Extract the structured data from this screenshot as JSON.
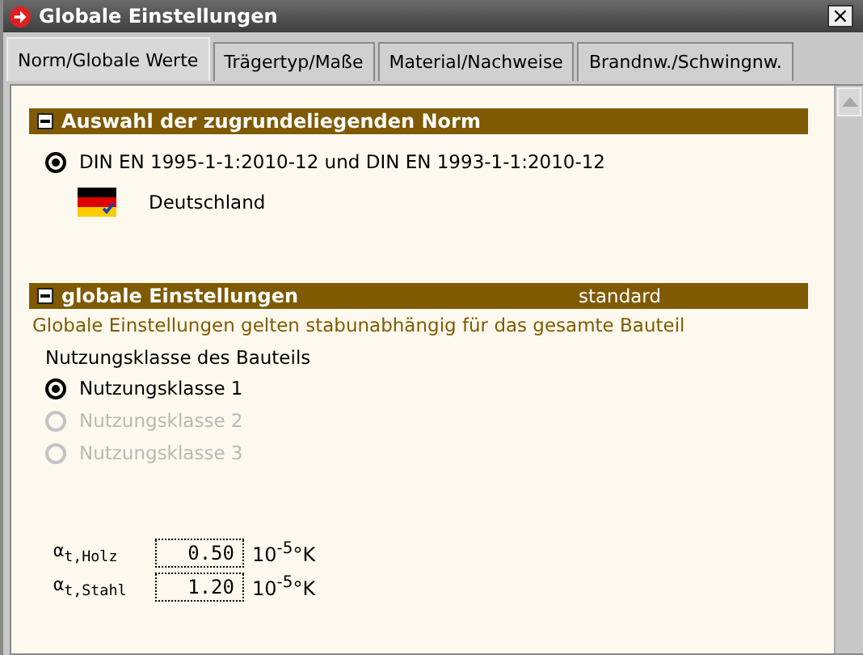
{
  "window": {
    "title": "Globale Einstellungen",
    "close": "×"
  },
  "tabs": [
    {
      "label": "Norm/Globale Werte",
      "selected": true
    },
    {
      "label": "Trägertyp/Maße",
      "selected": false
    },
    {
      "label": "Material/Nachweise",
      "selected": false
    },
    {
      "label": "Brandnw./Schwingnw.",
      "selected": false
    }
  ],
  "norm_section": {
    "title": "Auswahl der zugrundeliegenden Norm",
    "expanded": true,
    "options": [
      {
        "label": "DIN EN 1995-1-1:2010-12 und DIN EN 1993-1-1:2010-12",
        "selected": true
      }
    ],
    "country": "Deutschland"
  },
  "global_section": {
    "title": "globale Einstellungen",
    "expanded": true,
    "badge": "standard",
    "note": "Globale Einstellungen gelten stabunabhängig für das gesamte Bauteil",
    "group_label": "Nutzungsklasse des Bauteils",
    "options": [
      {
        "label": "Nutzungsklasse 1",
        "selected": true,
        "disabled": false
      },
      {
        "label": "Nutzungsklasse 2",
        "selected": false,
        "disabled": true
      },
      {
        "label": "Nutzungsklasse 3",
        "selected": false,
        "disabled": true
      }
    ],
    "fields": [
      {
        "label": "α$_{t,Holz}$",
        "value": "0.50",
        "unit": "10$^{-5}$°K"
      },
      {
        "label": "α$_{t,Stahl}$",
        "value": "1.20",
        "unit": "10$^{-5}$°K"
      }
    ]
  }
}
